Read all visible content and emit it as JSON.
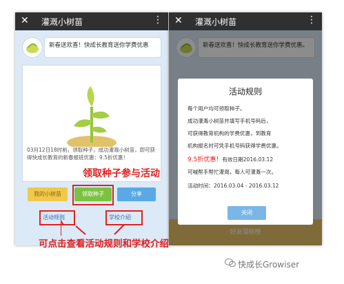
{
  "left": {
    "app_title": "灌溉小树苗",
    "welcome": "新春送欢喜！快成长教育送你学费优惠",
    "description": "03月12日18时前，领取种子，成功灌溉小树苗，即可获得快成长教育的新春报班优惠：9.5折优惠！",
    "buttons": {
      "my_tree": "我的小树苗",
      "get_seed": "领取种子",
      "share": "分享"
    },
    "links": {
      "rules": "活动规则",
      "school": "学校介绍"
    }
  },
  "annotations": {
    "seed_tip": "领取种子参与活动",
    "bottom_tip": "可点击查看活动规则和学校介绍"
  },
  "right": {
    "app_title": "灌溉小树苗",
    "welcome": "新春送欢喜！快成长教育送你学费优惠。",
    "modal": {
      "title": "活动规则",
      "line1": "每个用户均可领取种子。",
      "line2": "成功灌溉小树苗并填写手机号码后，",
      "line3": "可获得教育机构的学费优惠，到教育",
      "line4": "机构报名时可凭手机号码获得学费优惠。",
      "line5_red": "9.5折优惠！",
      "line5_rest": "有效日期2016.03.12",
      "line6": "可喊帮手帮忙灌溉，每人可灌溉一次。",
      "line7": "活动时间：2016.03.04 - 2016.03.12",
      "close": "关闭"
    },
    "bottom_bar": "好友溜树榜"
  },
  "watermark": "快成长Growiser",
  "colors": {
    "topbar": "#303030",
    "yellow_button": "#f0c84a",
    "green_button": "#7cc242",
    "blue_button": "#5aa9e6",
    "annotation_red": "#e02020"
  }
}
